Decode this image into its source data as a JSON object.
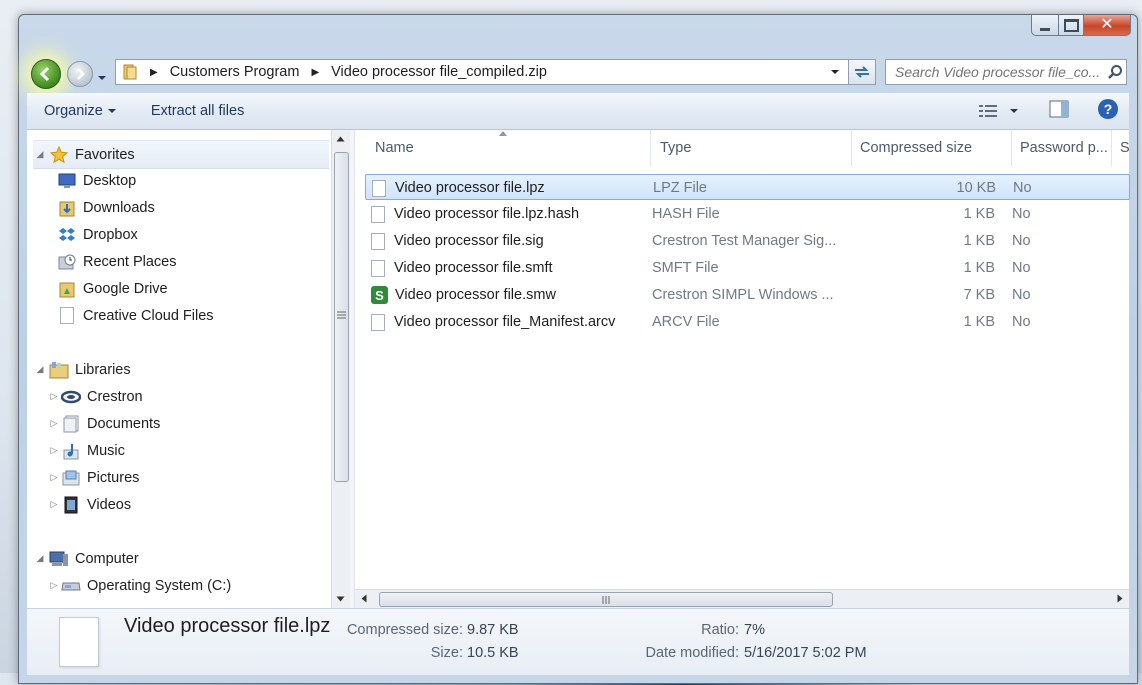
{
  "window": {
    "caption": {
      "close": "✕"
    }
  },
  "navigation": {
    "breadcrumb": [
      "Customers Program",
      "Video processor file_compiled.zip"
    ],
    "search_placeholder": "Search Video processor file_co..."
  },
  "toolbar": {
    "organize": "Organize",
    "extract": "Extract all files"
  },
  "nav_pane": {
    "favorites_label": "Favorites",
    "favorites": [
      {
        "label": "Desktop",
        "icon": "desktop-icon"
      },
      {
        "label": "Downloads",
        "icon": "downloads-icon"
      },
      {
        "label": "Dropbox",
        "icon": "dropbox-icon"
      },
      {
        "label": "Recent Places",
        "icon": "recent-places-icon"
      },
      {
        "label": "Google Drive",
        "icon": "google-drive-icon"
      },
      {
        "label": "Creative Cloud Files",
        "icon": "file-icon"
      }
    ],
    "libraries_label": "Libraries",
    "libraries": [
      {
        "label": "Crestron",
        "icon": "crestron-icon"
      },
      {
        "label": "Documents",
        "icon": "documents-icon"
      },
      {
        "label": "Music",
        "icon": "music-icon"
      },
      {
        "label": "Pictures",
        "icon": "pictures-icon"
      },
      {
        "label": "Videos",
        "icon": "videos-icon"
      }
    ],
    "computer_label": "Computer",
    "computer": [
      {
        "label": "Operating System (C:)",
        "icon": "drive-icon"
      }
    ]
  },
  "file_list": {
    "columns": {
      "name": "Name",
      "type": "Type",
      "size": "Compressed size",
      "password": "Password p...",
      "overflow": "S"
    },
    "rows": [
      {
        "name": "Video processor file.lpz",
        "type": "LPZ File",
        "size": "10 KB",
        "password": "No",
        "icon": "file-icon",
        "selected": true
      },
      {
        "name": "Video processor file.lpz.hash",
        "type": "HASH File",
        "size": "1 KB",
        "password": "No",
        "icon": "file-icon"
      },
      {
        "name": "Video processor file.sig",
        "type": "Crestron Test Manager Sig...",
        "size": "1 KB",
        "password": "No",
        "icon": "file-icon"
      },
      {
        "name": "Video processor file.smft",
        "type": "SMFT File",
        "size": "1 KB",
        "password": "No",
        "icon": "file-icon"
      },
      {
        "name": "Video processor file.smw",
        "type": "Crestron SIMPL Windows ...",
        "size": "7 KB",
        "password": "No",
        "icon": "simpl-windows-icon",
        "icon_text": "S"
      },
      {
        "name": "Video processor file_Manifest.arcv",
        "type": "ARCV File",
        "size": "1 KB",
        "password": "No",
        "icon": "file-icon"
      }
    ]
  },
  "details": {
    "name": "Video processor file.lpz",
    "compressed_label": "Compressed size:",
    "compressed_value": "9.87 KB",
    "size_label": "Size:",
    "size_value": "10.5 KB",
    "ratio_label": "Ratio:",
    "ratio_value": "7%",
    "modified_label": "Date modified:",
    "modified_value": "5/16/2017 5:02 PM"
  }
}
